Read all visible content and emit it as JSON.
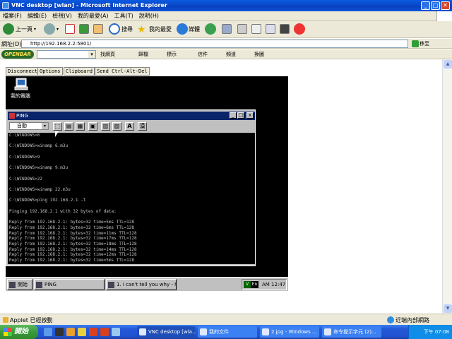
{
  "window": {
    "title": "VNC desktop [wlan] - Microsoft Internet Explorer",
    "min": "_",
    "max": "□",
    "close": "✕"
  },
  "menu": [
    "檔案(F)",
    "編輯(E)",
    "檢視(V)",
    "我的最愛(A)",
    "工具(T)",
    "說明(H)"
  ],
  "toolbar": {
    "back": "上一頁",
    "search": "搜尋",
    "favorites": "我的最愛",
    "media": "媒體"
  },
  "address": {
    "label": "網址(D)",
    "url": "http://192.168.2.2:5801/",
    "go": "移至"
  },
  "openbar": {
    "logo": "OPENBAR",
    "items": [
      "找網頁",
      "歸檔",
      "標示",
      "信件",
      "頻道",
      "換圖"
    ]
  },
  "vnc": {
    "buttons": [
      "Disconnect",
      "Options",
      "Clipboard",
      "Send Ctrl-Alt-Del"
    ],
    "desktop_icon_label": "我的電腦",
    "ping_window": {
      "title": "PING",
      "font_select": "自動",
      "font_button": "A",
      "ime_button": "漢",
      "console": "C:\\WINDOWS>6\n\nC:\\WINDOWS>winamp 6.m3u\n\nC:\\WINDOWS>9\n\nC:\\WINDOWS>winamp 9.m3u\n\nC:\\WINDOWS>22\n\nC:\\WINDOWS>winamp 22.m3u\n\nC:\\WINDOWS>ping 192.168.2.1 -t\n\nPinging 192.168.2.1 with 32 bytes of data:\n\nReply from 192.168.2.1: bytes=32 time=5ms TTL=128\nReply from 192.168.2.1: bytes=32 time=6ms TTL=128\nReply from 192.168.2.1: bytes=32 time=11ms TTL=128\nReply from 192.168.2.1: bytes=32 time=17ms TTL=128\nReply from 192.168.2.1: bytes=32 time=18ms TTL=128\nReply from 192.168.2.1: bytes=32 time=14ms TTL=128\nReply from 192.168.2.1: bytes=32 time=12ms TTL=128\nReply from 192.168.2.1: bytes=32 time=5ms TTL=128"
    },
    "taskbar": {
      "start": "開始",
      "task1": "PING",
      "task2": "1. i can't tell you why - hell...",
      "clock": "AM 12:47",
      "ime": "V",
      "lang": "En"
    }
  },
  "status": {
    "left": "Applet 已經啟動",
    "right": "近端內部網路"
  },
  "xp_taskbar": {
    "start": "開始",
    "tasks": [
      "VNC desktop [wla...",
      "我的文件",
      "2.jpg - Windows ...",
      "命令提示字元 (2)..."
    ],
    "clock": "下午 07:08"
  }
}
